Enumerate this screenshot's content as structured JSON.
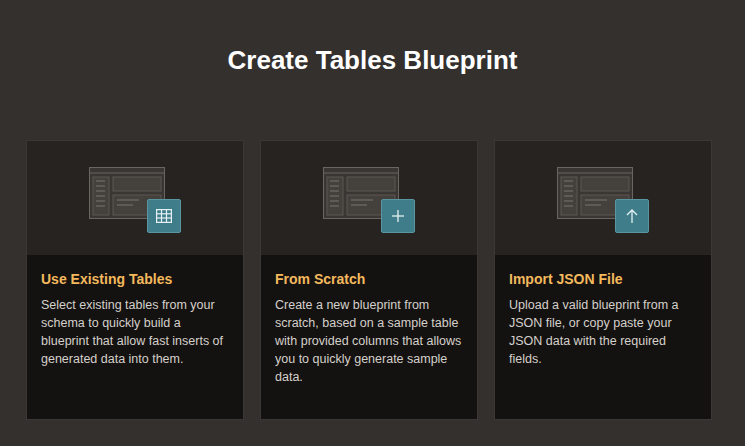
{
  "page": {
    "title": "Create Tables Blueprint"
  },
  "cards": [
    {
      "title": "Use Existing Tables",
      "description": "Select existing tables from your schema to quickly build a blueprint that allow fast inserts of generated data into them.",
      "kind": "table"
    },
    {
      "title": "From Scratch",
      "description": "Create a new blueprint from scratch, based on a sample table with provided columns that allows you to quickly generate sample data.",
      "kind": "plus"
    },
    {
      "title": "Import JSON File",
      "description": "Upload a valid blueprint from a JSON file, or copy paste your JSON data with the required fields.",
      "kind": "upload"
    }
  ]
}
